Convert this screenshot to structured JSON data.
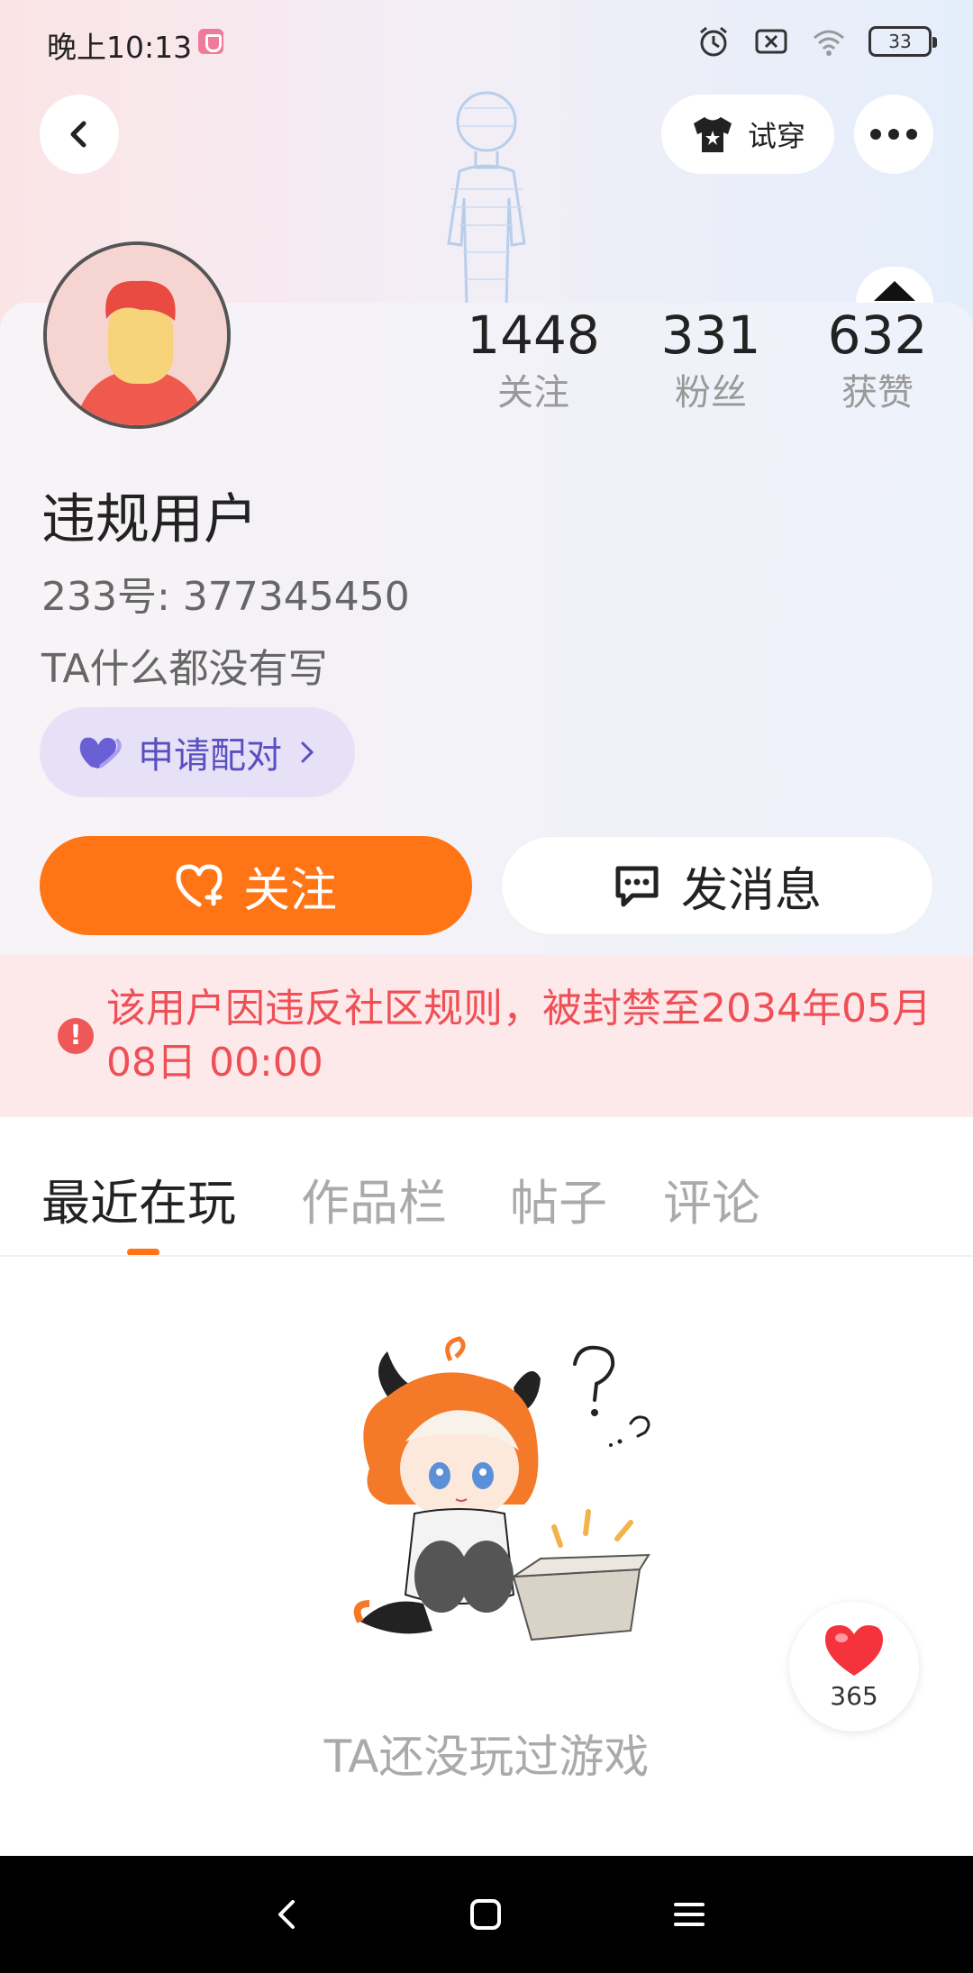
{
  "status_bar": {
    "time": "晚上10:13",
    "battery": "33"
  },
  "header": {
    "try_on_label": "试穿"
  },
  "profile": {
    "stats": [
      {
        "value": "1448",
        "label": "关注"
      },
      {
        "value": "331",
        "label": "粉丝"
      },
      {
        "value": "632",
        "label": "获赞"
      }
    ],
    "name": "违规用户",
    "uid": "233号: 377345450",
    "bio": "TA什么都没有写",
    "pair_label": "申请配对",
    "follow_label": "关注",
    "message_label": "发消息"
  },
  "ban_notice": {
    "text": "该用户因违反社区规则，被封禁至2034年05月08日 00:00"
  },
  "tabs": [
    {
      "label": "最近在玩",
      "active": true
    },
    {
      "label": "作品栏",
      "active": false
    },
    {
      "label": "帖子",
      "active": false
    },
    {
      "label": "评论",
      "active": false
    }
  ],
  "empty_state": {
    "text": "TA还没玩过游戏"
  },
  "like_float": {
    "count": "365"
  },
  "colors": {
    "accent": "#ff7414",
    "ban_red": "#ef4f55",
    "pair_purple": "#5a4fc0"
  },
  "icons": [
    "back-icon",
    "shirt-icon",
    "more-icon",
    "heart-icon",
    "heart-plus-icon",
    "chat-icon",
    "warning-icon",
    "chevron-right-icon",
    "nav-back-icon",
    "nav-home-icon",
    "nav-menu-icon"
  ]
}
